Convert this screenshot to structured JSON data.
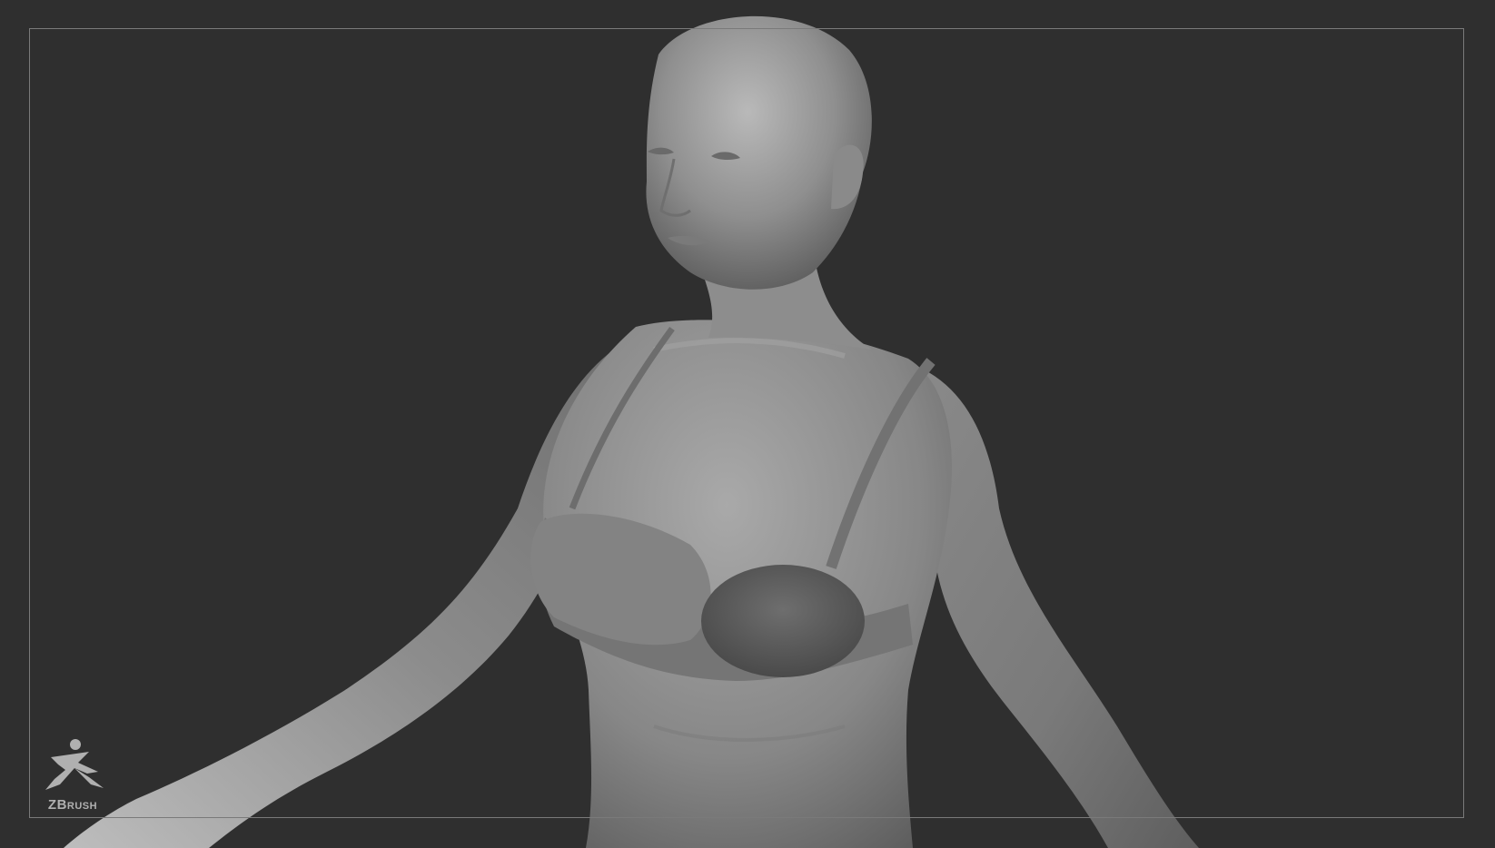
{
  "viewport": {
    "background": "#2f2f2f",
    "frame_color": "#7a7a7a"
  },
  "model": {
    "subject": "female-bust-sculpt",
    "material_color": "#8e8e8e"
  },
  "logo": {
    "icon": "zbrush-running-figure-icon",
    "text_z": "ZB",
    "text_rest": "RUSH"
  }
}
